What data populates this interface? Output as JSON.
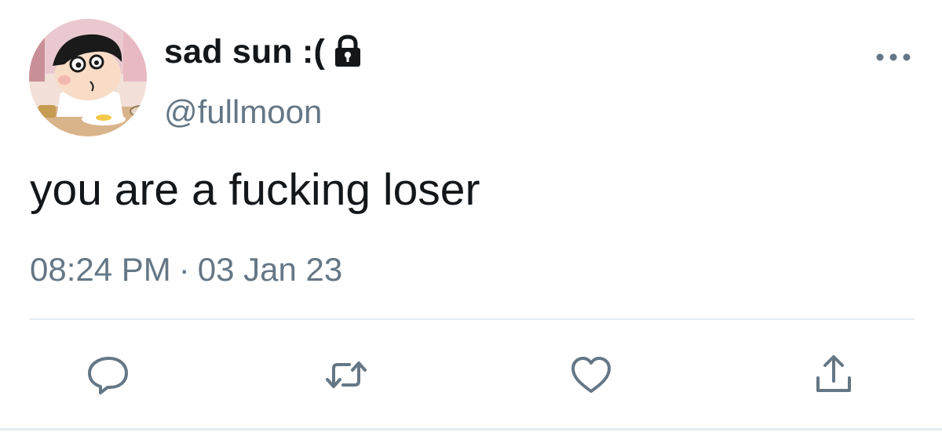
{
  "author": {
    "display_name": "sad sun :(",
    "handle": "@fullmoon",
    "protected_icon": "lock-icon",
    "avatar_icon": "cartoon-avatar"
  },
  "tweet": {
    "text": "you are a fucking loser",
    "time": "08:24 PM",
    "separator": "·",
    "date": "03 Jan 23"
  },
  "actions": [
    {
      "name": "reply",
      "icon": "comment-icon"
    },
    {
      "name": "retweet",
      "icon": "retweet-icon"
    },
    {
      "name": "like",
      "icon": "heart-icon"
    },
    {
      "name": "share",
      "icon": "share-icon"
    }
  ],
  "menu": {
    "icon": "more-icon"
  },
  "colors": {
    "text_primary": "#14171a",
    "text_secondary": "#657786",
    "divider": "#e6ecf0"
  }
}
